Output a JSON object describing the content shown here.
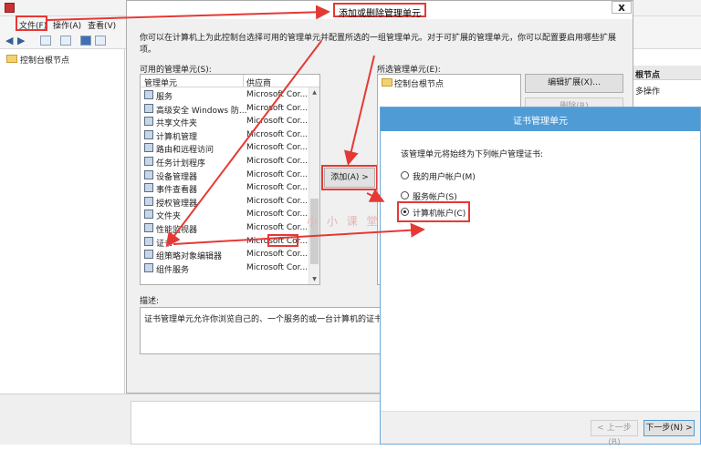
{
  "mmc": {
    "menu": [
      "文件(F)",
      "操作(A)",
      "查看(V)"
    ],
    "tree_root": "控制台根节点",
    "actions_header": "根节点",
    "actions_item": "多操作"
  },
  "add_remove_dialog": {
    "title": "添加或删除管理单元",
    "close": "x",
    "description": "你可以在计算机上为此控制台选择可用的管理单元并配置所选的一组管理单元。对于可扩展的管理单元，你可以配置要启用哪些扩展项。",
    "available_label": "可用的管理单元(S):",
    "columns": [
      "管理单元",
      "供应商"
    ],
    "snapins": [
      {
        "name": "服务",
        "vendor": "Microsoft Cor...",
        "icon": "gear-icon"
      },
      {
        "name": "高级安全 Windows 防...",
        "vendor": "Microsoft Cor...",
        "icon": "firewall-icon"
      },
      {
        "name": "共享文件夹",
        "vendor": "Microsoft Cor...",
        "icon": "shared-folder-icon"
      },
      {
        "name": "计算机管理",
        "vendor": "Microsoft Cor...",
        "icon": "computer-management-icon"
      },
      {
        "name": "路由和远程访问",
        "vendor": "Microsoft Cor...",
        "icon": "routing-icon"
      },
      {
        "name": "任务计划程序",
        "vendor": "Microsoft Cor...",
        "icon": "clock-icon"
      },
      {
        "name": "设备管理器",
        "vendor": "Microsoft Cor...",
        "icon": "device-manager-icon"
      },
      {
        "name": "事件查看器",
        "vendor": "Microsoft Cor...",
        "icon": "event-viewer-icon"
      },
      {
        "name": "授权管理器",
        "vendor": "Microsoft Cor...",
        "icon": "authorization-icon"
      },
      {
        "name": "文件夹",
        "vendor": "Microsoft Cor...",
        "icon": "folder-icon"
      },
      {
        "name": "性能监视器",
        "vendor": "Microsoft Cor...",
        "icon": "performance-icon"
      },
      {
        "name": "证书",
        "vendor": "Microsoft Cor...",
        "icon": "certificate-icon"
      },
      {
        "name": "组策略对象编辑器",
        "vendor": "Microsoft Cor...",
        "icon": "group-policy-icon"
      },
      {
        "name": "组件服务",
        "vendor": "Microsoft Cor...",
        "icon": "component-services-icon"
      }
    ],
    "add_button": "添加(A) >",
    "selected_label": "所选管理单元(E):",
    "selected_item": "控制台根节点",
    "edit_extensions_button": "编辑扩展(X)...",
    "remove_button": "删除(R)",
    "desc_label": "描述:",
    "desc_text": "证书管理单元允许你浏览自己的、一个服务的或一台计算机的证书存储"
  },
  "cert_wizard": {
    "title": "证书管理单元",
    "prompt": "该管理单元将始终为下列帐户管理证书:",
    "options": [
      "我的用户帐户(M)",
      "服务帐户(S)",
      "计算机帐户(C)"
    ],
    "selected_index": 2,
    "back_button": "< 上一步(B)",
    "next_button": "下一步(N) >"
  },
  "watermark": "小 小 课 堂",
  "colors": {
    "highlight": "#e53935",
    "wizard_title": "#4e9bd6"
  }
}
